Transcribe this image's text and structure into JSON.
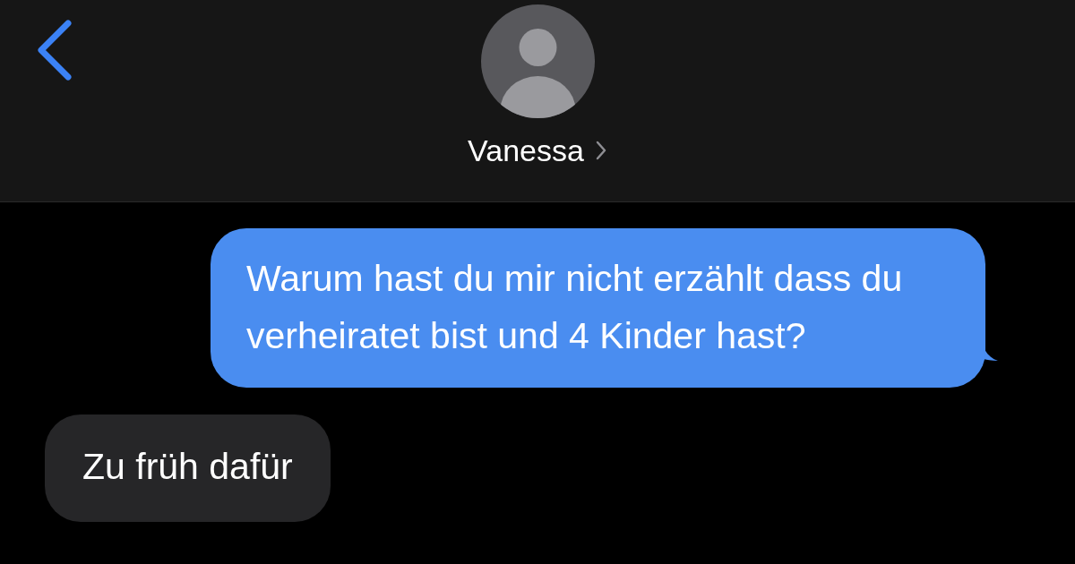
{
  "header": {
    "contact_name": "Vanessa"
  },
  "messages": [
    {
      "kind": "sent",
      "text": "Warum hast du mir nicht erzählt dass du verheiratet bist und 4 Kinder hast?"
    },
    {
      "kind": "received",
      "text": "Zu früh dafür"
    }
  ]
}
